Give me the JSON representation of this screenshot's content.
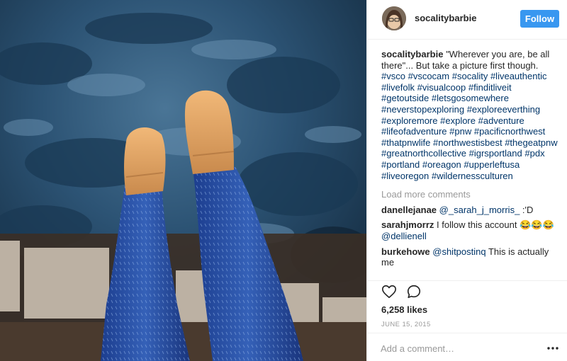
{
  "post": {
    "username": "socalitybarbie",
    "follow_label": "Follow",
    "caption_text": "\"Wherever you are, be all there\"... But take a picture first though.",
    "hashtags": [
      "#vsco",
      "#vscocam",
      "#socality",
      "#liveauthentic",
      "#livefolk",
      "#visualcoop",
      "#finditliveit",
      "#getoutside",
      "#letsgosomewhere",
      "#neverstopexploring",
      "#exploreeverthing",
      "#exploremore",
      "#explore",
      "#adventure",
      "#lifeofadventure",
      "#pnw",
      "#pacificnorthwest",
      "#thatpnwlife",
      "#northwestisbest",
      "#thegeatpnw",
      "#greatnorthcollective",
      "#igrsportland",
      "#pdx",
      "#portland",
      "#oreagon",
      "#upperleftusa",
      "#liveoregon",
      "#wildernessculturen"
    ],
    "load_more": "Load more comments",
    "comments": [
      {
        "user": "danellejanae",
        "mention": "@_sarah_j_morris_",
        "text": " :'D"
      },
      {
        "user": "sarahjmorrz",
        "text": " I follow this account 😂😂😂 ",
        "mention": "@dellienell"
      },
      {
        "user": "burkehowe",
        "mention": "@shitpostinq",
        "text": " This is actually me"
      }
    ],
    "likes": "6,258 likes",
    "date": "JUNE 15, 2015",
    "add_comment_placeholder": "Add a comment…"
  },
  "icons": {
    "like": "heart-icon",
    "comment": "speech-bubble-icon",
    "more": "ellipsis-icon"
  },
  "colors": {
    "follow_button": "#3897f0",
    "hashtag": "#003569",
    "muted": "#999999",
    "text": "#262626",
    "divider": "#efefef"
  }
}
